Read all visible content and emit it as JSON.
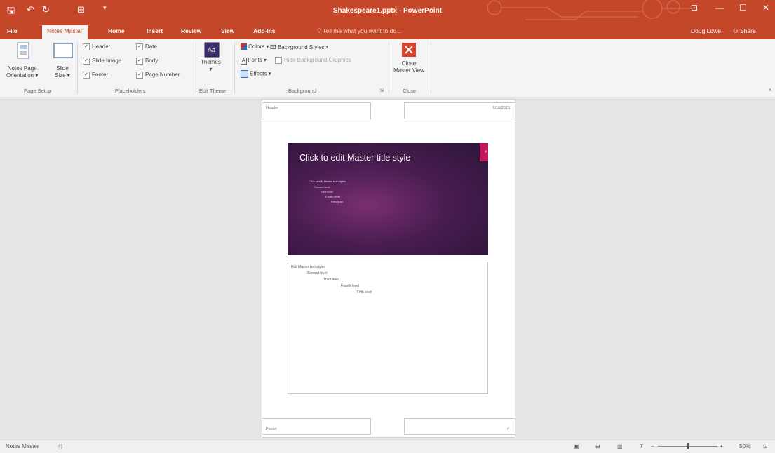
{
  "window": {
    "title": "Shakespeare1.pptx - PowerPoint",
    "user": "Doug Lowe",
    "share": "Share"
  },
  "ribbon_tabs": [
    "File",
    "Notes Master",
    "Home",
    "Insert",
    "Review",
    "View",
    "Add-Ins"
  ],
  "tell_me": "Tell me what you want to do...",
  "page_setup": {
    "orientation_line1": "Notes Page",
    "orientation_line2": "Orientation",
    "size_line1": "Slide",
    "size_line2": "Size",
    "group_label": "Page Setup"
  },
  "placeholders": {
    "header": "Header",
    "date": "Date",
    "slide_image": "Slide Image",
    "body": "Body",
    "footer": "Footer",
    "page_number": "Page Number",
    "group_label": "Placeholders"
  },
  "edit_theme": {
    "themes": "Themes",
    "group_label": "Edit Theme"
  },
  "background": {
    "colors": "Colors",
    "background_styles": "Background Styles",
    "fonts": "Fonts",
    "hide_graphics": "Hide Background Graphics",
    "effects": "Effects",
    "group_label": "Background"
  },
  "close_group": {
    "line1": "Close",
    "line2": "Master View",
    "group_label": "Close"
  },
  "notes_page": {
    "header": "Header",
    "date": "6/16/2015",
    "footer": "Footer",
    "page_num": "#",
    "slide_title": "Click to edit Master title style",
    "slide_text_lines": [
      "Click to edit Master text styles",
      "Second level",
      "Third level",
      "Fourth level",
      "Fifth level"
    ],
    "notes_lines": [
      "Edit Master text styles",
      "Second level",
      "Third level",
      "Fourth level",
      "Fifth level"
    ]
  },
  "status": {
    "view": "Notes Master",
    "zoom": "50%",
    "zoom_level": 0.5
  },
  "colors": {
    "accent": "#c4472a",
    "slide_bg": "#4a1d52",
    "slide_tag": "#c2185b"
  }
}
